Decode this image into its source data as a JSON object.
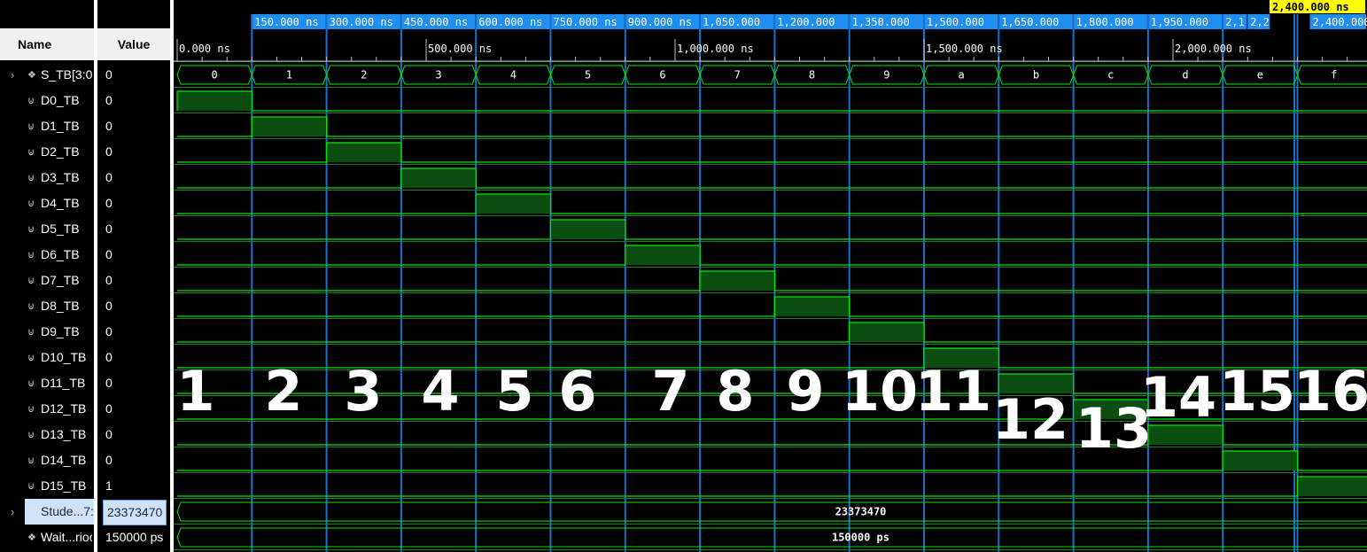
{
  "header": {
    "name_label": "Name",
    "value_label": "Value"
  },
  "signals": [
    {
      "name": "S_TB[3:0]",
      "value": "0",
      "kind": "bus",
      "expandable": true
    },
    {
      "name": "D0_TB",
      "value": "0",
      "kind": "bit"
    },
    {
      "name": "D1_TB",
      "value": "0",
      "kind": "bit"
    },
    {
      "name": "D2_TB",
      "value": "0",
      "kind": "bit"
    },
    {
      "name": "D3_TB",
      "value": "0",
      "kind": "bit"
    },
    {
      "name": "D4_TB",
      "value": "0",
      "kind": "bit"
    },
    {
      "name": "D5_TB",
      "value": "0",
      "kind": "bit"
    },
    {
      "name": "D6_TB",
      "value": "0",
      "kind": "bit"
    },
    {
      "name": "D7_TB",
      "value": "0",
      "kind": "bit"
    },
    {
      "name": "D8_TB",
      "value": "0",
      "kind": "bit"
    },
    {
      "name": "D9_TB",
      "value": "0",
      "kind": "bit"
    },
    {
      "name": "D10_TB",
      "value": "0",
      "kind": "bit"
    },
    {
      "name": "D11_TB",
      "value": "0",
      "kind": "bit"
    },
    {
      "name": "D12_TB",
      "value": "0",
      "kind": "bit"
    },
    {
      "name": "D13_TB",
      "value": "0",
      "kind": "bit"
    },
    {
      "name": "D14_TB",
      "value": "0",
      "kind": "bit"
    },
    {
      "name": "D15_TB",
      "value": "1",
      "kind": "bit"
    },
    {
      "name": "Stude...7:0",
      "value": "23373470",
      "kind": "bus",
      "expandable": true,
      "selected": true
    },
    {
      "name": "Wait...riod",
      "value": "150000 ps",
      "kind": "param"
    }
  ],
  "timeline": {
    "cursor_label": "2,400.000 ns",
    "marker_labels": [
      "150.000 ns",
      "300.000 ns",
      "450.000 ns",
      "600.000 ns",
      "750.000 ns",
      "900.000 ns",
      "1,050.000",
      "1,200.000",
      "1,350.000",
      "1,500.000",
      "1,650.000",
      "1,800.000",
      "1,950.000",
      "2,1",
      "2,2",
      "2,400.000 ns"
    ],
    "ruler_labels": [
      "0.000 ns",
      "500.000 ns",
      "1,000.000 ns",
      "1,500.000 ns",
      "2,000.000 ns"
    ],
    "s_tb_values": [
      "0",
      "1",
      "2",
      "3",
      "4",
      "5",
      "6",
      "7",
      "8",
      "9",
      "a",
      "b",
      "c",
      "d",
      "e",
      "f"
    ],
    "student_id_value": "23373470",
    "wait_period_value": "150000 ps"
  },
  "annotations": [
    "1",
    "2",
    "3",
    "4",
    "5",
    "6",
    "7",
    "8",
    "9",
    "10",
    "11",
    "12",
    "13",
    "14",
    "15",
    "16"
  ],
  "colors": {
    "wave": "#00e800",
    "wave_fill": "#0b4d10",
    "marker_line": "#1e6ecd",
    "marker_label_bg": "#1e8ef0",
    "cursor_bg": "#ffff00",
    "row_divider": "#1f7f1f"
  }
}
